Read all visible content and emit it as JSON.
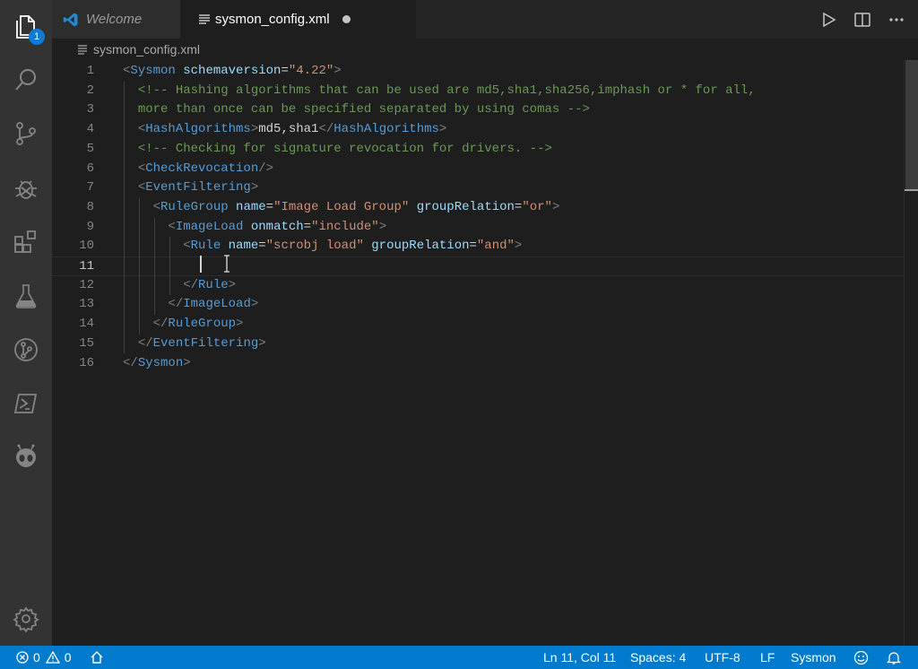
{
  "activity_bar": {
    "explorer_badge": "1",
    "icons": [
      "files-icon",
      "search-icon",
      "source-control-icon",
      "debug-icon",
      "extensions-icon",
      "testing-icon",
      "git-graph-icon",
      "powershell-icon",
      "alien-icon",
      "settings-gear-icon"
    ]
  },
  "tabs": [
    {
      "label": "Welcome",
      "active": false,
      "italic": true
    },
    {
      "label": "sysmon_config.xml",
      "active": true,
      "dirty": true
    }
  ],
  "breadcrumb": {
    "file": "sysmon_config.xml"
  },
  "editor": {
    "current_line": 11,
    "line_numbers": [
      "1",
      "2",
      "3",
      "4",
      "5",
      "6",
      "7",
      "8",
      "9",
      "10",
      "11",
      "12",
      "13",
      "14",
      "15",
      "16"
    ],
    "lines": [
      [
        {
          "c": "t-br",
          "t": "<"
        },
        {
          "c": "t-tag",
          "t": "Sysmon"
        },
        {
          "c": "t-tx",
          "t": " "
        },
        {
          "c": "t-attr",
          "t": "schemaversion"
        },
        {
          "c": "t-eq",
          "t": "="
        },
        {
          "c": "t-str",
          "t": "\"4.22\""
        },
        {
          "c": "t-br",
          "t": ">"
        }
      ],
      [
        {
          "c": "t-tx",
          "t": "  "
        },
        {
          "c": "t-cm",
          "t": "<!-- Hashing algorithms that can be used are md5,sha1,sha256,imphash or * for all,"
        }
      ],
      [
        {
          "c": "t-tx",
          "t": "  "
        },
        {
          "c": "t-cm",
          "t": "more than once can be specified separated by using comas -->"
        }
      ],
      [
        {
          "c": "t-tx",
          "t": "  "
        },
        {
          "c": "t-br",
          "t": "<"
        },
        {
          "c": "t-tag",
          "t": "HashAlgorithms"
        },
        {
          "c": "t-br",
          "t": ">"
        },
        {
          "c": "t-tx",
          "t": "md5,sha1"
        },
        {
          "c": "t-br",
          "t": "</"
        },
        {
          "c": "t-tag",
          "t": "HashAlgorithms"
        },
        {
          "c": "t-br",
          "t": ">"
        }
      ],
      [
        {
          "c": "t-tx",
          "t": "  "
        },
        {
          "c": "t-cm",
          "t": "<!-- Checking for signature revocation for drivers. -->"
        }
      ],
      [
        {
          "c": "t-tx",
          "t": "  "
        },
        {
          "c": "t-br",
          "t": "<"
        },
        {
          "c": "t-tag",
          "t": "CheckRevocation"
        },
        {
          "c": "t-br",
          "t": "/>"
        }
      ],
      [
        {
          "c": "t-tx",
          "t": "  "
        },
        {
          "c": "t-br",
          "t": "<"
        },
        {
          "c": "t-tag",
          "t": "EventFiltering"
        },
        {
          "c": "t-br",
          "t": ">"
        }
      ],
      [
        {
          "c": "t-tx",
          "t": "    "
        },
        {
          "c": "t-br",
          "t": "<"
        },
        {
          "c": "t-tag",
          "t": "RuleGroup"
        },
        {
          "c": "t-tx",
          "t": " "
        },
        {
          "c": "t-attr",
          "t": "name"
        },
        {
          "c": "t-eq",
          "t": "="
        },
        {
          "c": "t-str",
          "t": "\"Image Load Group\""
        },
        {
          "c": "t-tx",
          "t": " "
        },
        {
          "c": "t-attr",
          "t": "groupRelation"
        },
        {
          "c": "t-eq",
          "t": "="
        },
        {
          "c": "t-str",
          "t": "\"or\""
        },
        {
          "c": "t-br",
          "t": ">"
        }
      ],
      [
        {
          "c": "t-tx",
          "t": "      "
        },
        {
          "c": "t-br",
          "t": "<"
        },
        {
          "c": "t-tag",
          "t": "ImageLoad"
        },
        {
          "c": "t-tx",
          "t": " "
        },
        {
          "c": "t-attr",
          "t": "onmatch"
        },
        {
          "c": "t-eq",
          "t": "="
        },
        {
          "c": "t-str",
          "t": "\"include\""
        },
        {
          "c": "t-br",
          "t": ">"
        }
      ],
      [
        {
          "c": "t-tx",
          "t": "        "
        },
        {
          "c": "t-br",
          "t": "<"
        },
        {
          "c": "t-tag",
          "t": "Rule"
        },
        {
          "c": "t-tx",
          "t": " "
        },
        {
          "c": "t-attr",
          "t": "name"
        },
        {
          "c": "t-eq",
          "t": "="
        },
        {
          "c": "t-str",
          "t": "\"scrobj load\""
        },
        {
          "c": "t-tx",
          "t": " "
        },
        {
          "c": "t-attr",
          "t": "groupRelation"
        },
        {
          "c": "t-eq",
          "t": "="
        },
        {
          "c": "t-str",
          "t": "\"and\""
        },
        {
          "c": "t-br",
          "t": ">"
        }
      ],
      [],
      [
        {
          "c": "t-tx",
          "t": "        "
        },
        {
          "c": "t-br",
          "t": "</"
        },
        {
          "c": "t-tag",
          "t": "Rule"
        },
        {
          "c": "t-br",
          "t": ">"
        }
      ],
      [
        {
          "c": "t-tx",
          "t": "      "
        },
        {
          "c": "t-br",
          "t": "</"
        },
        {
          "c": "t-tag",
          "t": "ImageLoad"
        },
        {
          "c": "t-br",
          "t": ">"
        }
      ],
      [
        {
          "c": "t-tx",
          "t": "    "
        },
        {
          "c": "t-br",
          "t": "</"
        },
        {
          "c": "t-tag",
          "t": "RuleGroup"
        },
        {
          "c": "t-br",
          "t": ">"
        }
      ],
      [
        {
          "c": "t-tx",
          "t": "  "
        },
        {
          "c": "t-br",
          "t": "</"
        },
        {
          "c": "t-tag",
          "t": "EventFiltering"
        },
        {
          "c": "t-br",
          "t": ">"
        }
      ],
      [
        {
          "c": "t-br",
          "t": "</"
        },
        {
          "c": "t-tag",
          "t": "Sysmon"
        },
        {
          "c": "t-br",
          "t": ">"
        }
      ]
    ]
  },
  "status_bar": {
    "errors": "0",
    "warnings": "0",
    "position": "Ln 11, Col 11",
    "indent": "Spaces: 4",
    "encoding": "UTF-8",
    "eol": "LF",
    "language": "Sysmon"
  },
  "colors": {
    "accent": "#007acc",
    "tag": "#569cd6",
    "attribute": "#9cdcfe",
    "string": "#ce9178",
    "comment": "#6a9955"
  }
}
